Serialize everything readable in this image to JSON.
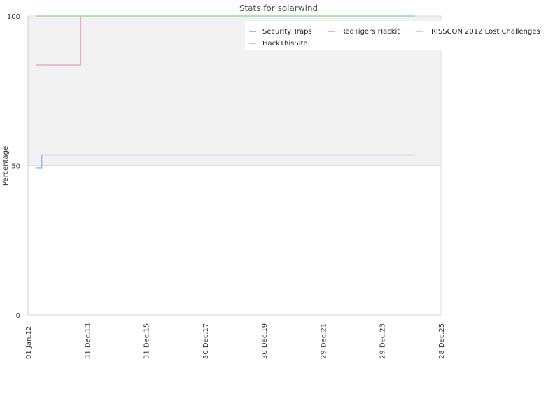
{
  "chart_data": {
    "type": "line",
    "title": "Stats for solarwind",
    "xlabel": "",
    "ylabel": "Percentage",
    "ylim": [
      0,
      100
    ],
    "yticks": [
      0,
      50,
      100
    ],
    "xlim": [
      "2012-01-01",
      "2025-12-28"
    ],
    "xticks": [
      {
        "date": "2012-01-01",
        "label": "01.Jan.12"
      },
      {
        "date": "2013-12-31",
        "label": "31.Dec.13"
      },
      {
        "date": "2015-12-31",
        "label": "31.Dec.15"
      },
      {
        "date": "2017-12-30",
        "label": "30.Dec.17"
      },
      {
        "date": "2019-12-30",
        "label": "30.Dec.19"
      },
      {
        "date": "2021-12-29",
        "label": "29.Dec.21"
      },
      {
        "date": "2023-12-29",
        "label": "29.Dec.23"
      },
      {
        "date": "2025-12-28",
        "label": "28.Dec.25"
      }
    ],
    "shaded_band": [
      50,
      100
    ],
    "grid": true,
    "legend_position": "top-right",
    "series": [
      {
        "name": "Security Traps",
        "color": "#90c0f0",
        "step": true,
        "points": [
          [
            "2012-04-15",
            49.2
          ],
          [
            "2012-06-20",
            53.5
          ],
          [
            "2025-02-10",
            53.5
          ]
        ]
      },
      {
        "name": "RedTigers Hackit",
        "color": "#f0a8cc",
        "step": true,
        "points": [
          [
            "2012-04-15",
            83.6
          ],
          [
            "2013-10-15",
            100
          ],
          [
            "2013-10-16",
            100
          ]
        ]
      },
      {
        "name": "IRISSCON 2012 Lost Challenges",
        "color": "#a0e8c8",
        "step": true,
        "points": [
          [
            "2012-04-15",
            100
          ],
          [
            "2025-02-10",
            100
          ]
        ]
      },
      {
        "name": "HackThisSite",
        "color": "#a8e0a0",
        "step": true,
        "points": [
          [
            "2012-04-15",
            100
          ],
          [
            "2025-02-10",
            100
          ]
        ]
      }
    ]
  }
}
